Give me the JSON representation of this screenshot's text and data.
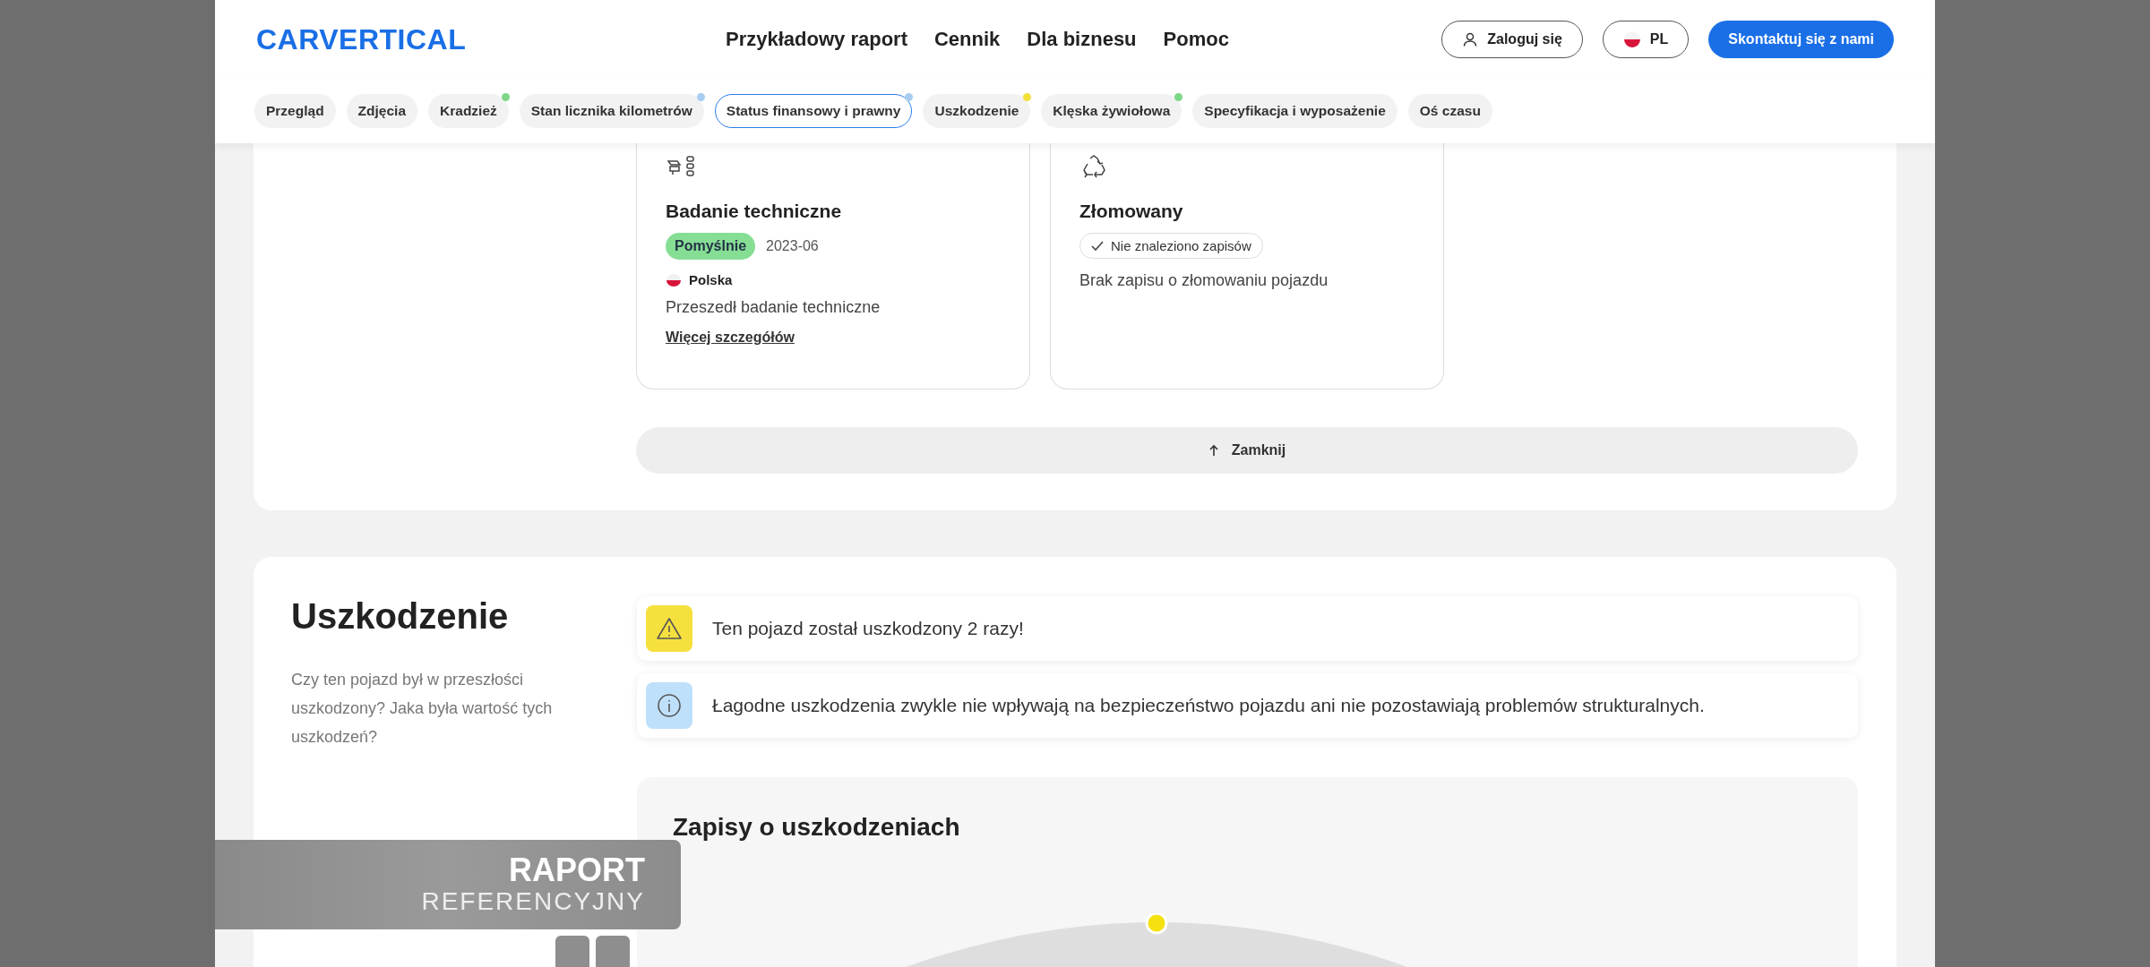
{
  "header": {
    "logo": "CARVERTICAL",
    "nav": [
      "Przykładowy raport",
      "Cennik",
      "Dla biznesu",
      "Pomoc"
    ],
    "login": "Zaloguj się",
    "language": "PL",
    "contact": "Skontaktuj się z nami"
  },
  "tabs": [
    {
      "label": "Przegląd",
      "selected": false
    },
    {
      "label": "Zdjęcia",
      "selected": false
    },
    {
      "label": "Kradzież",
      "selected": false,
      "color": "#7ed687"
    },
    {
      "label": "Stan licznika kilometrów",
      "selected": false,
      "color": "#a9cdf0"
    },
    {
      "label": "Status finansowy i prawny",
      "selected": true,
      "color": "#a9cdf0"
    },
    {
      "label": "Uszkodzenie",
      "selected": false,
      "color": "#f2e03a"
    },
    {
      "label": "Klęska żywiołowa",
      "selected": false,
      "color": "#7ed687"
    },
    {
      "label": "Specyfikacja i wyposażenie",
      "selected": false
    },
    {
      "label": "Oś czasu",
      "selected": false
    }
  ],
  "records": [
    {
      "kind": "inspection",
      "title": "Badanie techniczne",
      "status": "Pomyślnie",
      "date": "2023-06",
      "country": "Polska",
      "text": "Przeszedł badanie techniczne",
      "link": "Więcej szczegółów"
    },
    {
      "kind": "scrapped",
      "title": "Złomowany",
      "status": "Nie znaleziono zapisów",
      "text": "Brak zapisu o złomowaniu pojazdu"
    }
  ],
  "close_button": "Zamknij",
  "damage": {
    "title": "Uszkodzenie",
    "description": "Czy ten pojazd był w przeszłości uszkodzony? Jaka była wartość tych uszkodzeń?",
    "alerts": [
      {
        "kind": "warning",
        "text": "Ten pojazd został uszkodzony 2 razy!"
      },
      {
        "kind": "info",
        "text": "Łagodne uszkodzenia zwykle nie wpływają na bezpieczeństwo pojazdu ani nie pozostawiają problemów strukturalnych."
      }
    ],
    "records_title": "Zapisy o uszkodzeniach"
  },
  "overlay": {
    "title": "RAPORT",
    "subtitle": "REFERENCYJNY"
  }
}
